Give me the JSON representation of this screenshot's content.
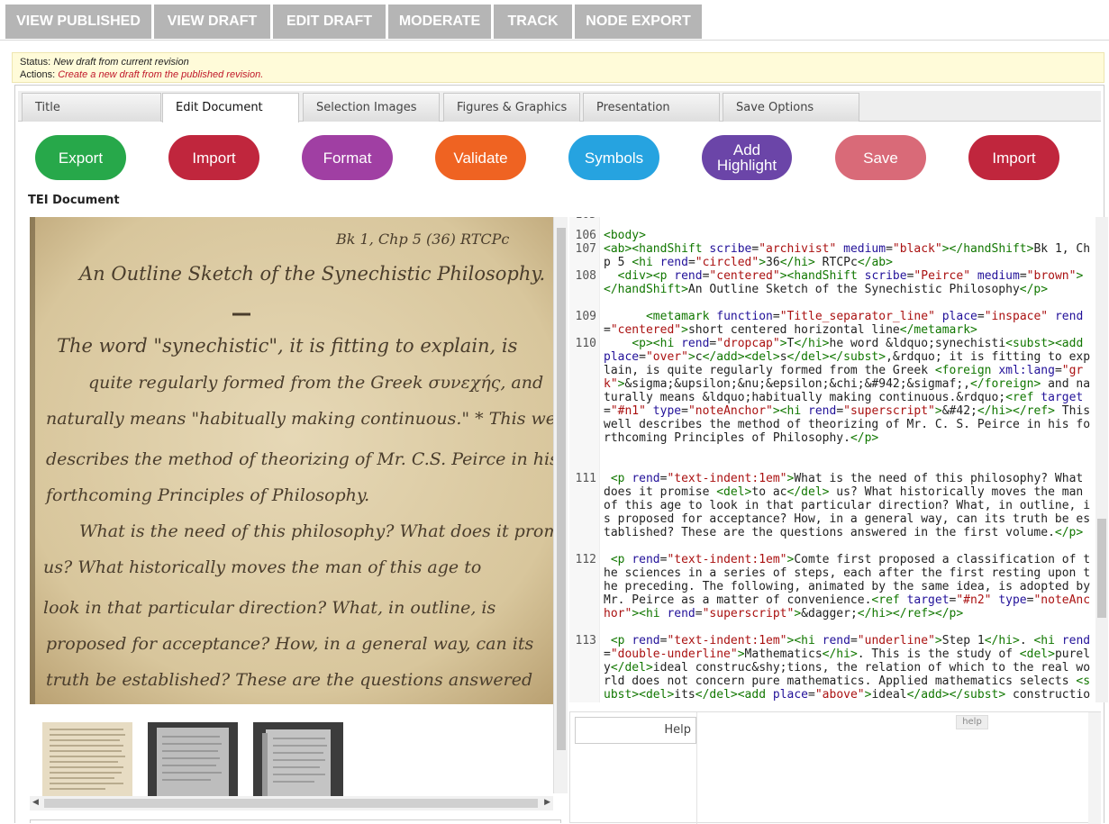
{
  "top_tabs": [
    "VIEW PUBLISHED",
    "VIEW DRAFT",
    "EDIT DRAFT",
    "MODERATE",
    "TRACK",
    "NODE EXPORT"
  ],
  "status": {
    "status_label": "Status:",
    "status_value": "New draft from current revision",
    "actions_label": "Actions:",
    "actions_link": "Create a new draft from the published revision."
  },
  "sub_tabs": [
    "Title",
    "Edit Document",
    "Selection Images",
    "Figures & Graphics",
    "Presentation",
    "Save Options"
  ],
  "active_sub_tab": "Edit Document",
  "toolbar": [
    {
      "label": "Export",
      "color": "#27a84a"
    },
    {
      "label": "Import",
      "color": "#c0263d"
    },
    {
      "label": "Format",
      "color": "#a03fa3"
    },
    {
      "label": "Validate",
      "color": "#ef6322"
    },
    {
      "label": "Symbols",
      "color": "#26a3e0"
    },
    {
      "label": "Add Highlight",
      "color": "#6b45a8"
    },
    {
      "label": "Save",
      "color": "#d96a78"
    },
    {
      "label": "Import",
      "color": "#c0263d"
    }
  ],
  "tei_label": "TEI Document",
  "manuscript": {
    "header_note": "Bk 1, Chp 5 (36) RTCPc",
    "title": "An Outline Sketch of the Synechistic Philosophy.",
    "lines": [
      "The word \"synechistic\", it is fitting to explain, is",
      "quite regularly formed from the Greek συνεχής, and",
      "naturally means \"habitually making continuous.\" * This well",
      "describes the method of theorizing of Mr. C.S. Peirce in his",
      "forthcoming Principles of Philosophy.",
      "What is the need of this philosophy? What does it promise",
      "us? What historically moves the man of this age to",
      "look in that particular direction? What, in outline, is",
      "proposed for acceptance? How, in a general way, can its",
      "truth be established? These are the questions answered"
    ]
  },
  "code": {
    "first_line_partial": "105",
    "lines": [
      {
        "n": "106",
        "html": "<span class=\"tg\">&lt;body&gt;</span>"
      },
      {
        "n": "107",
        "html": "<span class=\"tg\">&lt;ab&gt;&lt;handShift</span> <span class=\"at\">scribe</span>=<span class=\"st\">\"archivist\"</span> <span class=\"at\">medium</span>=<span class=\"st\">\"black\"</span><span class=\"tg\">&gt;&lt;/handShift&gt;</span>Bk 1, Chp 5 <span class=\"tg\">&lt;hi</span> <span class=\"at\">rend</span>=<span class=\"st\">\"circled\"</span><span class=\"tg\">&gt;</span>36<span class=\"tg\">&lt;/hi&gt;</span> RTCPc<span class=\"tg\">&lt;/ab&gt;</span>"
      },
      {
        "n": "108",
        "html": "  <span class=\"tg\">&lt;div&gt;&lt;p</span> <span class=\"at\">rend</span>=<span class=\"st\">\"centered\"</span><span class=\"tg\">&gt;&lt;handShift</span> <span class=\"at\">scribe</span>=<span class=\"st\">\"Peirce\"</span> <span class=\"at\">medium</span>=<span class=\"st\">\"brown\"</span><span class=\"tg\">&gt;&lt;/handShift&gt;</span>An Outline Sketch of the Synechistic Philosophy<span class=\"tg\">&lt;/p&gt;</span>"
      },
      {
        "n": "109",
        "html": "      <span class=\"tg\">&lt;metamark</span> <span class=\"at\">function</span>=<span class=\"st\">\"Title_separator_line\"</span> <span class=\"at\">place</span>=<span class=\"st\">\"inspace\"</span> <span class=\"at\">rend</span>=<span class=\"st\">\"centered\"</span><span class=\"tg\">&gt;</span>short centered horizontal line<span class=\"tg\">&lt;/metamark&gt;</span>"
      },
      {
        "n": "110",
        "html": "    <span class=\"tg\">&lt;p&gt;&lt;hi</span> <span class=\"at\">rend</span>=<span class=\"st\">\"dropcap\"</span><span class=\"tg\">&gt;</span>T<span class=\"tg\">&lt;/hi&gt;</span>he word &amp;ldquo;synechisti<span class=\"tg\">&lt;subst&gt;&lt;add</span> <span class=\"at\">place</span>=<span class=\"st\">\"over\"</span><span class=\"tg\">&gt;</span>c<span class=\"tg\">&lt;/add&gt;&lt;del&gt;</span>s<span class=\"tg\">&lt;/del&gt;&lt;/subst&gt;</span>,&amp;rdquo; it is fitting to explain, is quite regularly formed from the Greek <span class=\"tg\">&lt;foreign</span> <span class=\"at\">xml:lang</span>=<span class=\"st\">\"grk\"</span><span class=\"tg\">&gt;</span>&amp;sigma;&amp;upsilon;&amp;nu;&amp;epsilon;&amp;chi;&amp;#942;&amp;sigmaf;,<span class=\"tg\">&lt;/foreign&gt;</span> and naturally means &amp;ldquo;habitually making continuous.&amp;rdquo;<span class=\"tg\">&lt;ref</span> <span class=\"at\">target</span>=<span class=\"st\">\"#n1\"</span> <span class=\"at\">type</span>=<span class=\"st\">\"noteAnchor\"</span><span class=\"tg\">&gt;&lt;hi</span> <span class=\"at\">rend</span>=<span class=\"st\">\"superscript\"</span><span class=\"tg\">&gt;</span>&amp;#42;<span class=\"tg\">&lt;/hi&gt;&lt;/ref&gt;</span> This well describes the method of theorizing of Mr. C. S. Peirce in his forthcoming Principles of Philosophy.<span class=\"tg\">&lt;/p&gt;</span>"
      },
      {
        "n": "111",
        "html": " <span class=\"tg\">&lt;p</span> <span class=\"at\">rend</span>=<span class=\"st\">\"text-indent:1em\"</span><span class=\"tg\">&gt;</span>What is the need of this philosophy? What does it promise <span class=\"tg\">&lt;del&gt;</span>to ac<span class=\"tg\">&lt;/del&gt;</span> us? What historically moves the man of this age to look in that particular direction? What, in outline, is proposed for acceptance? How, in a general way, can its truth be established? These are the questions answered in the first volume.<span class=\"tg\">&lt;/p&gt;</span>"
      },
      {
        "n": "112",
        "html": " <span class=\"tg\">&lt;p</span> <span class=\"at\">rend</span>=<span class=\"st\">\"text-indent:1em\"</span><span class=\"tg\">&gt;</span>Comte first proposed a classification of the sciences in a series of steps, each after the first resting upon the preceding. The following, animated by the same idea, is adopted by Mr. Peirce as a matter of convenience.<span class=\"tg\">&lt;ref</span> <span class=\"at\">target</span>=<span class=\"st\">\"#n2\"</span> <span class=\"at\">type</span>=<span class=\"st\">\"noteAnchor\"</span><span class=\"tg\">&gt;&lt;hi</span> <span class=\"at\">rend</span>=<span class=\"st\">\"superscript\"</span><span class=\"tg\">&gt;</span>&amp;dagger;<span class=\"tg\">&lt;/hi&gt;&lt;/ref&gt;&lt;/p&gt;</span>"
      },
      {
        "n": "113",
        "html": " <span class=\"tg\">&lt;p</span> <span class=\"at\">rend</span>=<span class=\"st\">\"text-indent:1em\"</span><span class=\"tg\">&gt;&lt;hi</span> <span class=\"at\">rend</span>=<span class=\"st\">\"underline\"</span><span class=\"tg\">&gt;</span>Step 1<span class=\"tg\">&lt;/hi&gt;</span>. <span class=\"tg\">&lt;hi</span> <span class=\"at\">rend</span>=<span class=\"st\">\"double-underline\"</span><span class=\"tg\">&gt;</span>Mathematics<span class=\"tg\">&lt;/hi&gt;</span>. This is the study of <span class=\"tg\">&lt;del&gt;</span>purely<span class=\"tg\">&lt;/del&gt;</span>ideal construc&amp;shy;tions, the relation of which to the real world does not concern pure mathematics. Applied mathematics selects <span class=\"tg\">&lt;subst&gt;&lt;del&gt;</span>its<span class=\"tg\">&lt;/del&gt;&lt;add</span> <span class=\"at\">place</span>=<span class=\"st\">\"above\"</span><span class=\"tg\">&gt;</span>ideal<span class=\"tg\">&lt;/add&gt;&lt;/subst&gt;</span> constructions as <span class=\"tg\">&lt;subst&gt;</span>"
      }
    ]
  },
  "help": {
    "button_label": "Help",
    "badge": "help"
  }
}
